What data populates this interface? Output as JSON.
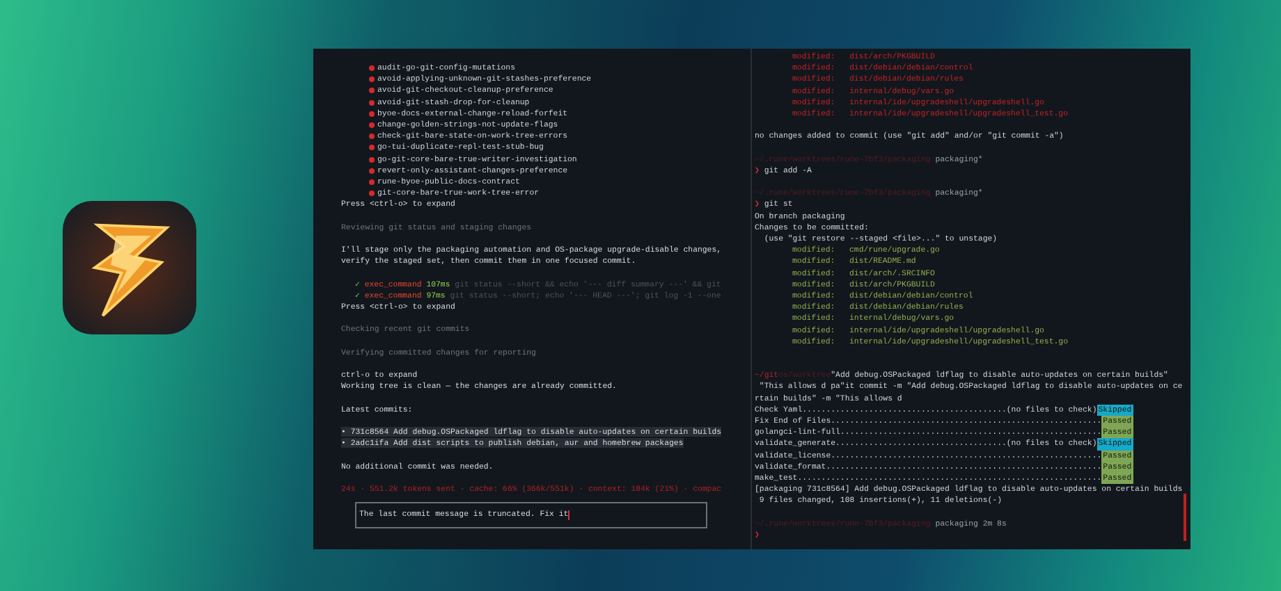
{
  "left_pane": {
    "lines": [
      {
        "kind": "item",
        "text": "audit-go-git-config-mutations"
      },
      {
        "kind": "item",
        "text": "avoid-applying-unknown-git-stashes-preference"
      },
      {
        "kind": "item",
        "text": "avoid-git-checkout-cleanup-preference"
      },
      {
        "kind": "item",
        "text": "avoid-git-stash-drop-for-cleanup"
      },
      {
        "kind": "item",
        "text": "byoe-docs-external-change-reload-forfeit"
      },
      {
        "kind": "item",
        "text": "change-golden-strings-not-update-flags"
      },
      {
        "kind": "item",
        "text": "check-git-bare-state-on-work-tree-errors"
      },
      {
        "kind": "item",
        "text": "go-tui-duplicate-repl-test-stub-bug"
      },
      {
        "kind": "item",
        "text": "go-git-core-bare-true-writer-investigation"
      },
      {
        "kind": "item",
        "text": "revert-only-assistant-changes-preference"
      },
      {
        "kind": "item",
        "text": "rune-byoe-public-docs-contract"
      },
      {
        "kind": "item",
        "text": "git-core-bare-true-work-tree-error"
      },
      {
        "kind": "text",
        "text": "Press <ctrl-o> to expand"
      },
      {
        "kind": "blank"
      },
      {
        "kind": "dim",
        "text": "Reviewing git status and staging changes"
      },
      {
        "kind": "blank"
      },
      {
        "kind": "text",
        "text": "I'll stage only the packaging automation and OS-package upgrade-disable changes,"
      },
      {
        "kind": "text",
        "text": "verify the staged set, then commit them in one focused commit."
      },
      {
        "kind": "blank"
      },
      {
        "kind": "tool",
        "mark": "✓",
        "tool": "exec_command",
        "time": "107ms",
        "command": "git status --short && echo '--- diff summary ---' && git"
      },
      {
        "kind": "tool",
        "mark": "✓",
        "tool": "exec_command",
        "time": "97ms",
        "command": "git status --short; echo '--- HEAD ---'; git log -1 --one"
      },
      {
        "kind": "text",
        "text": "Press <ctrl-o> to expand"
      },
      {
        "kind": "blank"
      },
      {
        "kind": "dim",
        "text": "Checking recent git commits"
      },
      {
        "kind": "blank"
      },
      {
        "kind": "dim",
        "text": "Verifying committed changes for reporting"
      },
      {
        "kind": "blank"
      },
      {
        "kind": "text",
        "text": "ctrl-o to expand"
      },
      {
        "kind": "text",
        "text": "Working tree is clean — the changes are already committed."
      },
      {
        "kind": "blank"
      },
      {
        "kind": "text",
        "text": "Latest commits:"
      },
      {
        "kind": "blank"
      },
      {
        "kind": "commit",
        "text": "• 731c8564 Add debug.OSPackaged ldflag to disable auto-updates on certain builds"
      },
      {
        "kind": "commit",
        "text": "• 2adc1ifa Add dist scripts to publish debian, aur and homebrew packages"
      },
      {
        "kind": "blank"
      },
      {
        "kind": "text",
        "text": "No additional commit was needed."
      },
      {
        "kind": "blank"
      },
      {
        "kind": "status",
        "text": "24s · 551.2k tokens sent · cache: 66% (366k/551k) · context: 184k (21%) · compac"
      }
    ],
    "input": {
      "value": "The last commit message is truncated. Fix it"
    }
  },
  "right_pane": {
    "lines": [
      {
        "kind": "change",
        "label": "modified:",
        "path": "dist/arch/PKGBUILD",
        "staged": false
      },
      {
        "kind": "change",
        "label": "modified:",
        "path": "dist/debian/debian/control",
        "staged": false
      },
      {
        "kind": "change",
        "label": "modified:",
        "path": "dist/debian/debian/rules",
        "staged": false
      },
      {
        "kind": "change",
        "label": "modified:",
        "path": "internal/debug/vars.go",
        "staged": false
      },
      {
        "kind": "change",
        "label": "modified:",
        "path": "internal/ide/upgradeshell/upgradeshell.go",
        "staged": false
      },
      {
        "kind": "change",
        "label": "modified:",
        "path": "internal/ide/upgradeshell/upgradeshell_test.go",
        "staged": false
      },
      {
        "kind": "blank"
      },
      {
        "kind": "text",
        "text": "no changes added to commit (use \"git add\" and/or \"git commit -a\")"
      },
      {
        "kind": "blank"
      },
      {
        "kind": "prompt",
        "path": "~/.rune/worktrees/rune-7bf3/packaging",
        "branch": "packaging*"
      },
      {
        "kind": "command",
        "symbol": "❯",
        "text": "git add -A"
      },
      {
        "kind": "blank"
      },
      {
        "kind": "prompt",
        "path": "~/.rune/worktrees/rune-7bf3/packaging",
        "branch": "packaging*"
      },
      {
        "kind": "command",
        "symbol": "❯",
        "text": "git st"
      },
      {
        "kind": "text",
        "text": "On branch packaging"
      },
      {
        "kind": "text",
        "text": "Changes to be committed:"
      },
      {
        "kind": "text",
        "text": "  (use \"git restore --staged <file>...\" to unstage)"
      },
      {
        "kind": "change",
        "label": "modified:",
        "path": "cmd/rune/upgrade.go",
        "staged": true
      },
      {
        "kind": "change",
        "label": "modified:",
        "path": "dist/README.md",
        "staged": true
      },
      {
        "kind": "change",
        "label": "modified:",
        "path": "dist/arch/.SRCINFO",
        "staged": true
      },
      {
        "kind": "change",
        "label": "modified:",
        "path": "dist/arch/PKGBUILD",
        "staged": true
      },
      {
        "kind": "change",
        "label": "modified:",
        "path": "dist/debian/debian/control",
        "staged": true
      },
      {
        "kind": "change",
        "label": "modified:",
        "path": "dist/debian/debian/rules",
        "staged": true
      },
      {
        "kind": "change",
        "label": "modified:",
        "path": "internal/debug/vars.go",
        "staged": true
      },
      {
        "kind": "change",
        "label": "modified:",
        "path": "internal/ide/upgradeshell/upgradeshell.go",
        "staged": true
      },
      {
        "kind": "change",
        "label": "modified:",
        "path": "internal/ide/upgradeshell/upgradeshell_test.go",
        "staged": true
      },
      {
        "kind": "blank"
      },
      {
        "kind": "blank"
      },
      {
        "kind": "typed",
        "prefix": "~/git",
        "faded": "os/worktree",
        "text": "\"Add debug.OSPackaged ldflag to disable auto-updates on certain builds\""
      },
      {
        "kind": "text",
        "text": " \"This allows d pa\"it commit -m \"Add debug.OSPackaged ldflag to disable auto-updates on ce"
      },
      {
        "kind": "text",
        "text": "rtain builds\" -m \"This allows d"
      },
      {
        "kind": "check",
        "text": "Check Yaml...........................................(no files to check)",
        "result": "Skipped",
        "color": "#17a9c9"
      },
      {
        "kind": "check",
        "text": "Fix End of Files.........................................................",
        "result": "Passed",
        "color": "#7fa654"
      },
      {
        "kind": "check",
        "text": "golangci-lint-full.......................................................",
        "result": "Passed",
        "color": "#7fa654"
      },
      {
        "kind": "check",
        "text": "validate_generate....................................(no files to check)",
        "result": "Skipped",
        "color": "#17a9c9"
      },
      {
        "kind": "check",
        "text": "validate_license.........................................................",
        "result": "Passed",
        "color": "#7fa654"
      },
      {
        "kind": "check",
        "text": "validate_format..........................................................",
        "result": "Passed",
        "color": "#7fa654"
      },
      {
        "kind": "check",
        "text": "make_test................................................................",
        "result": "Passed",
        "color": "#7fa654"
      },
      {
        "kind": "text",
        "text": "[packaging 731c8564] Add debug.OSPackaged ldflag to disable auto-updates on certain builds"
      },
      {
        "kind": "text",
        "text": " 9 files changed, 108 insertions(+), 11 deletions(-)"
      },
      {
        "kind": "blank"
      },
      {
        "kind": "prompt",
        "path": "~/.rune/worktrees/rune-7bf3/packaging",
        "branch": "packaging 2m 8s"
      },
      {
        "kind": "command",
        "symbol": "❯"
      }
    ]
  }
}
